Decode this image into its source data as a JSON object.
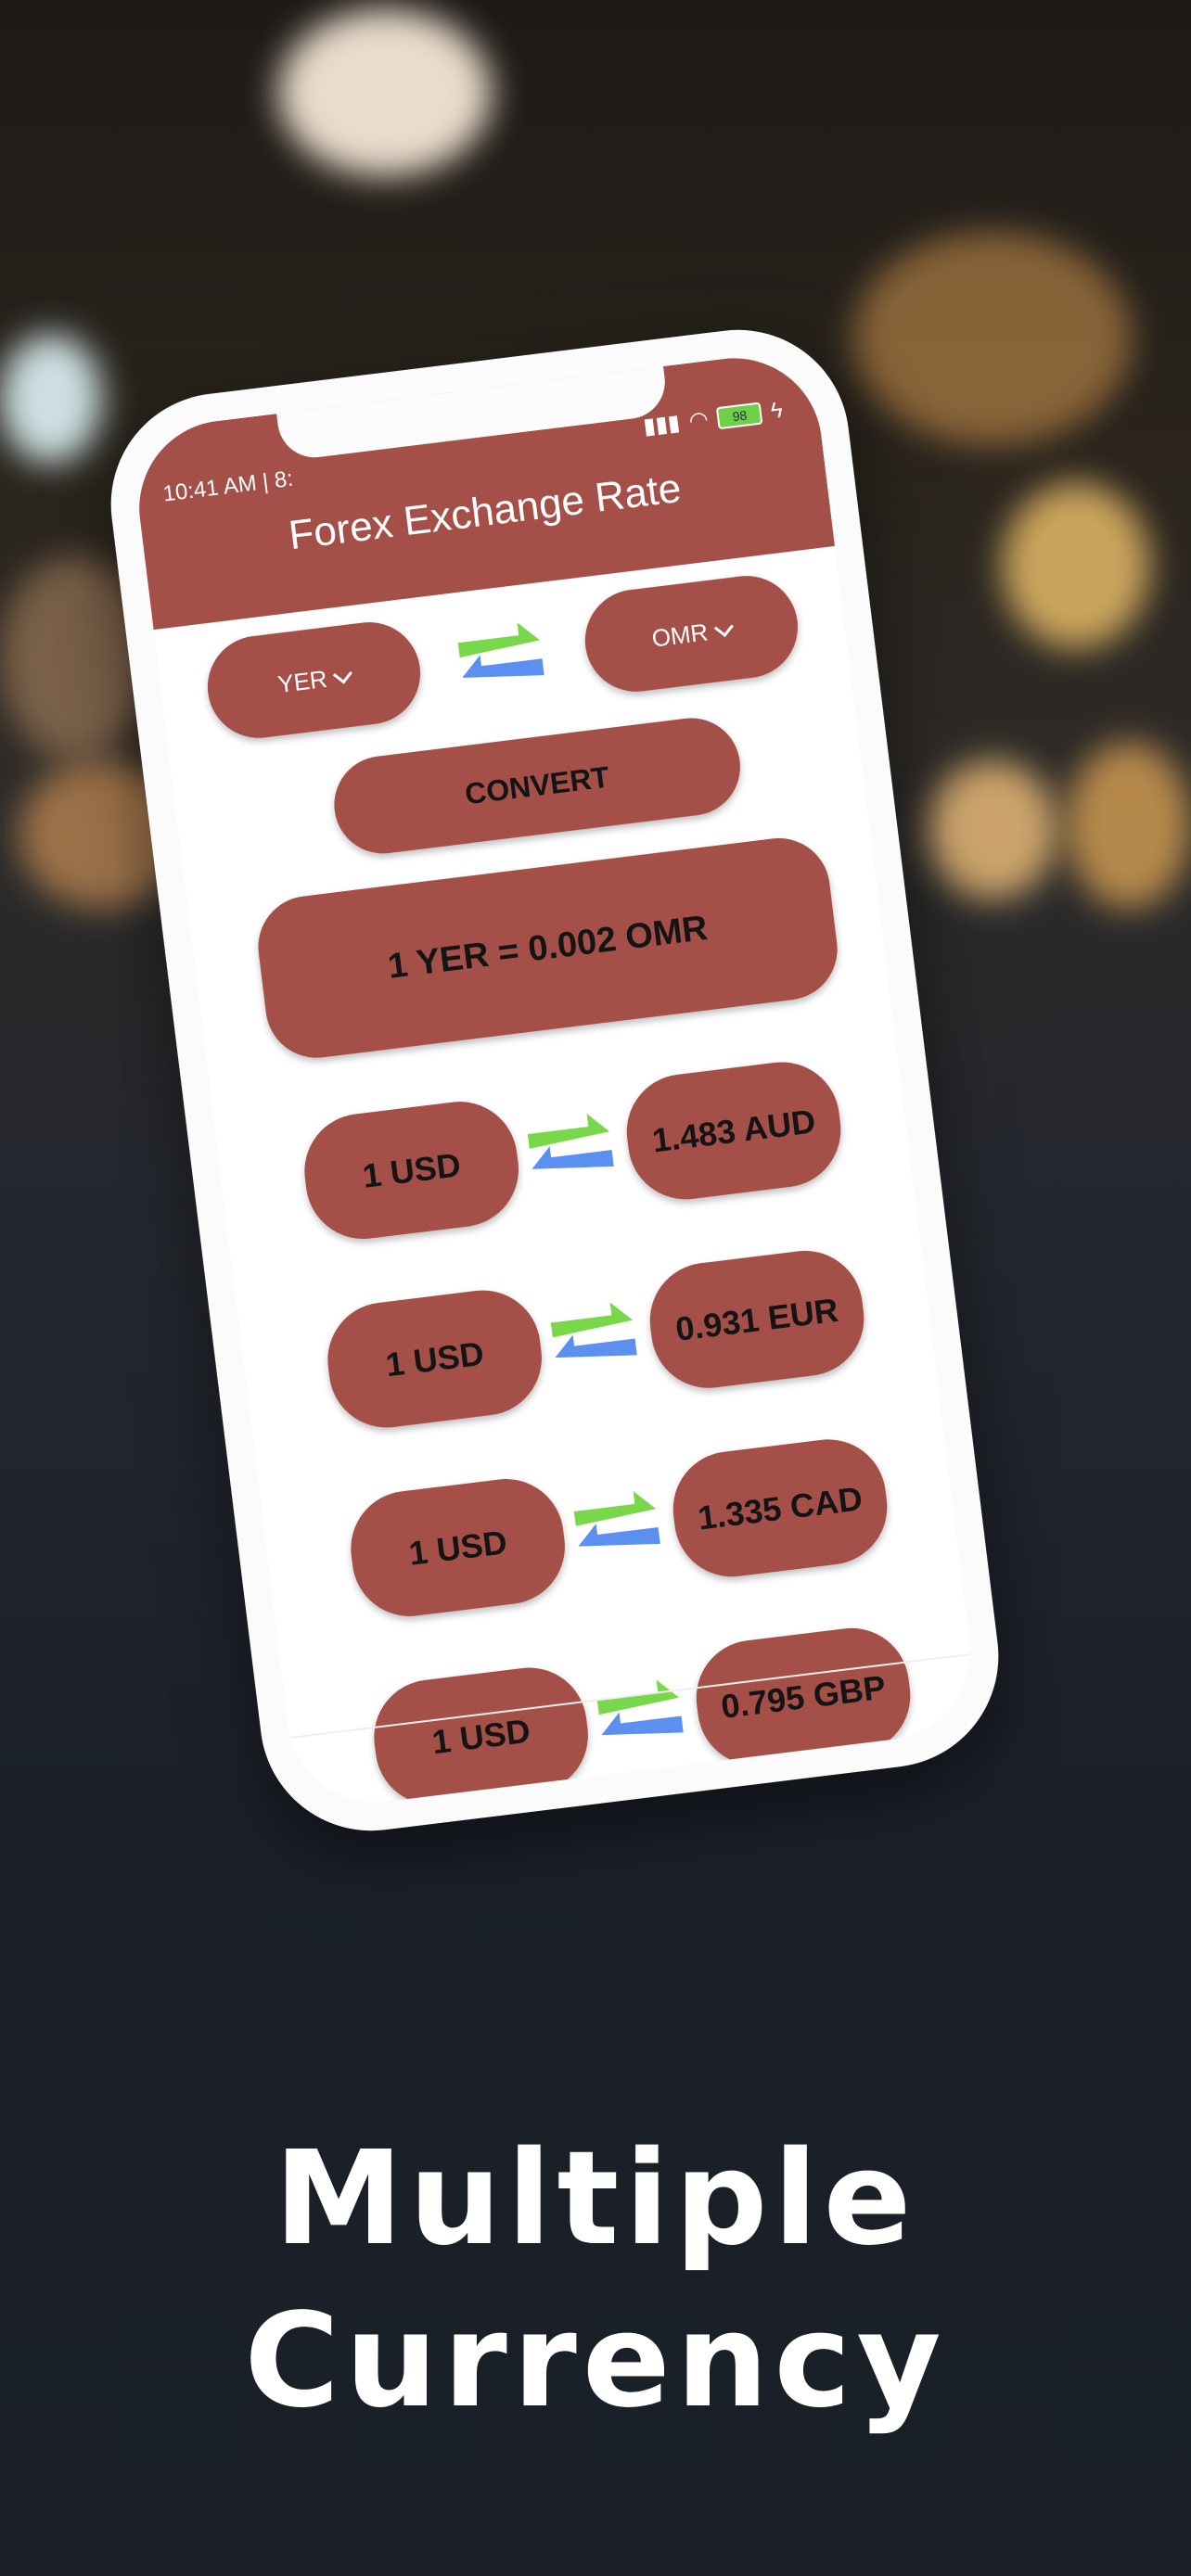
{
  "app": {
    "title": "Forex Exchange Rate"
  },
  "status": {
    "time": "10:41 AM | 8:",
    "battery": "98"
  },
  "selectors": {
    "from": "YER",
    "to": "OMR"
  },
  "convert_label": "CONVERT",
  "result": "1 YER = 0.002 OMR",
  "rates": [
    {
      "base": "1 USD",
      "quote": "1.483 AUD"
    },
    {
      "base": "1 USD",
      "quote": "0.931 EUR"
    },
    {
      "base": "1 USD",
      "quote": "1.335 CAD"
    },
    {
      "base": "1 USD",
      "quote": "0.795 GBP"
    }
  ],
  "headline": {
    "line1": "Multiple",
    "line2": "Currency"
  },
  "colors": {
    "accent": "#a54f49",
    "arrow_green": "#79d84a",
    "arrow_blue": "#5b8ff0"
  },
  "icons": [
    "swap-arrows-icon",
    "chevron-down-icon",
    "wifi-icon",
    "signal-icon",
    "battery-icon"
  ]
}
